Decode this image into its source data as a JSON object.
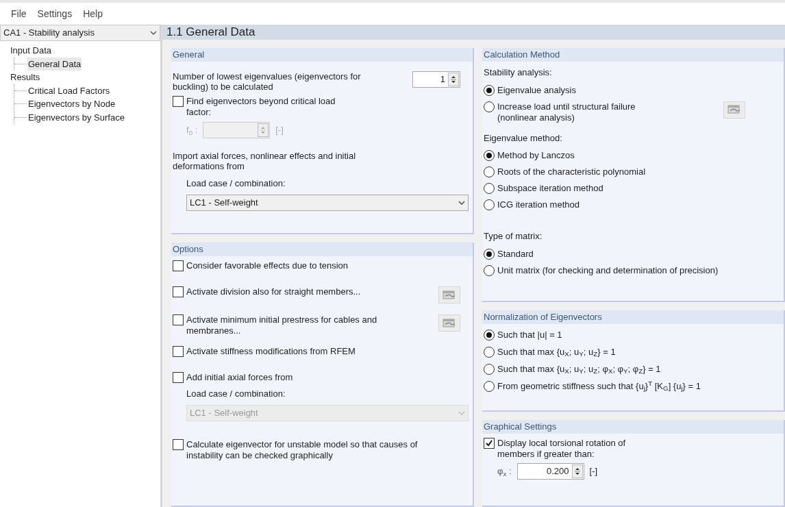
{
  "menu": [
    "File",
    "Settings",
    "Help"
  ],
  "sidebar": {
    "case": "CA1 - Stability analysis",
    "tree": [
      {
        "label": "Input Data",
        "selected": false,
        "children": [
          {
            "label": "General Data",
            "selected": true
          }
        ]
      },
      {
        "label": "Results",
        "selected": false,
        "children": [
          {
            "label": "Critical Load Factors",
            "selected": false
          },
          {
            "label": "Eigenvectors by Node",
            "selected": false
          },
          {
            "label": "Eigenvectors by Surface",
            "selected": false
          }
        ]
      }
    ]
  },
  "page_title": "1.1 General Data",
  "general": {
    "title": "General",
    "eigen_count": {
      "label": "Number of lowest eigenvalues (eigenvectors for buckling) to be calculated",
      "value": "1"
    },
    "find_beyond": {
      "label": "Find eigenvectors beyond critical load factor:",
      "checked": false
    },
    "f0": {
      "label": "f$_{0}$ :",
      "unit": "[-]",
      "disabled": true
    },
    "import_label": "Import axial forces, nonlinear effects and initial deformations from",
    "load_case": {
      "label": "Load case / combination:",
      "value": "LC1 - Self-weight",
      "disabled": false
    }
  },
  "options": {
    "title": "Options",
    "items": [
      {
        "kind": "checkbox",
        "label": "Consider favorable effects due to tension",
        "checked": false,
        "button": false
      },
      {
        "kind": "checkbox",
        "label": "Activate division also for straight members...",
        "checked": false,
        "button": true
      },
      {
        "kind": "checkbox",
        "label": "Activate minimum initial prestress for cables and membranes...",
        "checked": false,
        "button": true
      },
      {
        "kind": "checkbox",
        "label": "Activate stiffness modifications from RFEM",
        "checked": false,
        "button": false
      },
      {
        "kind": "checkbox",
        "label": "Add initial axial forces from",
        "checked": false,
        "button": false
      },
      {
        "kind": "combo",
        "label": "Load case / combination:",
        "value": "LC1 - Self-weight",
        "disabled": true
      },
      {
        "kind": "checkbox",
        "label": "Calculate eigenvector for unstable model so that causes of instability can be checked graphically",
        "checked": false,
        "button": false
      }
    ]
  },
  "calculation_method": {
    "title": "Calculation Method",
    "groups": [
      {
        "label": "Stability analysis:",
        "options": [
          {
            "label": "Eigenvalue analysis",
            "selected": true,
            "button": false
          },
          {
            "label": "Increase load until structural failure (nonlinear analysis)",
            "selected": false,
            "button": true
          }
        ]
      },
      {
        "label": "Eigenvalue method:",
        "options": [
          {
            "label": "Method by Lanczos",
            "selected": true,
            "button": false
          },
          {
            "label": "Roots of the characteristic polynomial",
            "selected": false,
            "button": false
          },
          {
            "label": "Subspace iteration method",
            "selected": false,
            "button": false
          },
          {
            "label": "ICG iteration method",
            "selected": false,
            "button": false
          }
        ]
      },
      {
        "label": "Type of matrix:",
        "options": [
          {
            "label": "Standard",
            "selected": true,
            "button": false
          },
          {
            "label": "Unit matrix (for checking and determination of precision)",
            "selected": false,
            "button": false
          }
        ]
      }
    ]
  },
  "normalization": {
    "title": "Normalization of Eigenvectors",
    "options": [
      {
        "label": "Such that |u| = 1",
        "selected": true
      },
      {
        "label": "Such that max {u$_{X}$; u$_{Y}$; u$_{Z}$} = 1",
        "selected": false
      },
      {
        "label": "Such that max {u$_{X}$; u$_{Y}$; u$_{Z}$; φ$_{X}$; φ$_{Y}$; φ$_{Z}$} = 1",
        "selected": false
      },
      {
        "label": "From geometric stiffness such that {u$_{j}$}$^{T}$ [K$_{G}$] {u$_{j}$} = 1",
        "selected": false
      }
    ]
  },
  "graphical": {
    "title": "Graphical Settings",
    "display": {
      "label": "Display local torsional rotation of members if greater than:",
      "checked": true
    },
    "phi": {
      "label": "φ$_{x}$ :",
      "value": "0.200",
      "unit": "[-]"
    }
  }
}
